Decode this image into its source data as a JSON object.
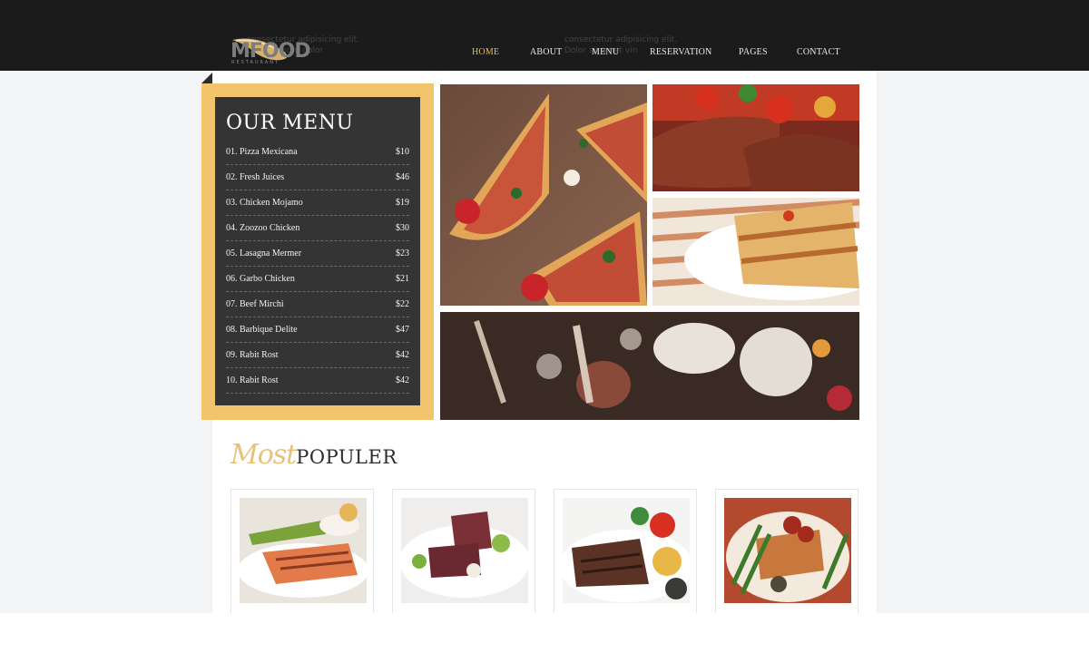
{
  "header": {
    "logo_word": "MFOOD",
    "logo_sub": "RESTAURANT",
    "ghost_text_left": "consectetur adipisicing elit. Lorem ipsum dolor",
    "ghost_text_right": "consectetur adipisicing elit. Dolor sit amet vin",
    "nav": [
      {
        "label": "HOME",
        "active": true
      },
      {
        "label": "ABOUT",
        "active": false
      },
      {
        "label": "MENU",
        "active": false
      },
      {
        "label": "RESERVATION",
        "active": false
      },
      {
        "label": "PAGES",
        "active": false
      },
      {
        "label": "CONTACT",
        "active": false
      }
    ]
  },
  "menu": {
    "title": "OUR MENU",
    "items": [
      {
        "name": "01. Pizza Mexicana",
        "price": "$10"
      },
      {
        "name": "02. Fresh Juices",
        "price": "$46"
      },
      {
        "name": "03. Chicken Mojamo",
        "price": "$19"
      },
      {
        "name": "04. Zoozoo Chicken",
        "price": "$30"
      },
      {
        "name": "05. Lasagna Mermer",
        "price": "$23"
      },
      {
        "name": "06. Garbo Chicken",
        "price": "$21"
      },
      {
        "name": "07. Beef Mirchi",
        "price": "$22"
      },
      {
        "name": "08. Barbique Delite",
        "price": "$47"
      },
      {
        "name": "09. Rabit Rost",
        "price": "$42"
      },
      {
        "name": "10. Rabit Rost",
        "price": "$42"
      }
    ]
  },
  "gallery": [
    {
      "name": "pizza-photo"
    },
    {
      "name": "steak-photo"
    },
    {
      "name": "lasagna-photo"
    },
    {
      "name": "dinner-table-photo"
    }
  ],
  "popular": {
    "script_word": "Most",
    "title_word": "POPULER",
    "cards": [
      {
        "name": "salmon-dish"
      },
      {
        "name": "lamb-dish"
      },
      {
        "name": "steak-dish"
      },
      {
        "name": "chicken-dish"
      }
    ]
  },
  "colors": {
    "accent": "#f2c46b",
    "nav_active": "#e8b85b",
    "header_bg": "#1b1b1b",
    "menu_card_bg": "#343434"
  }
}
